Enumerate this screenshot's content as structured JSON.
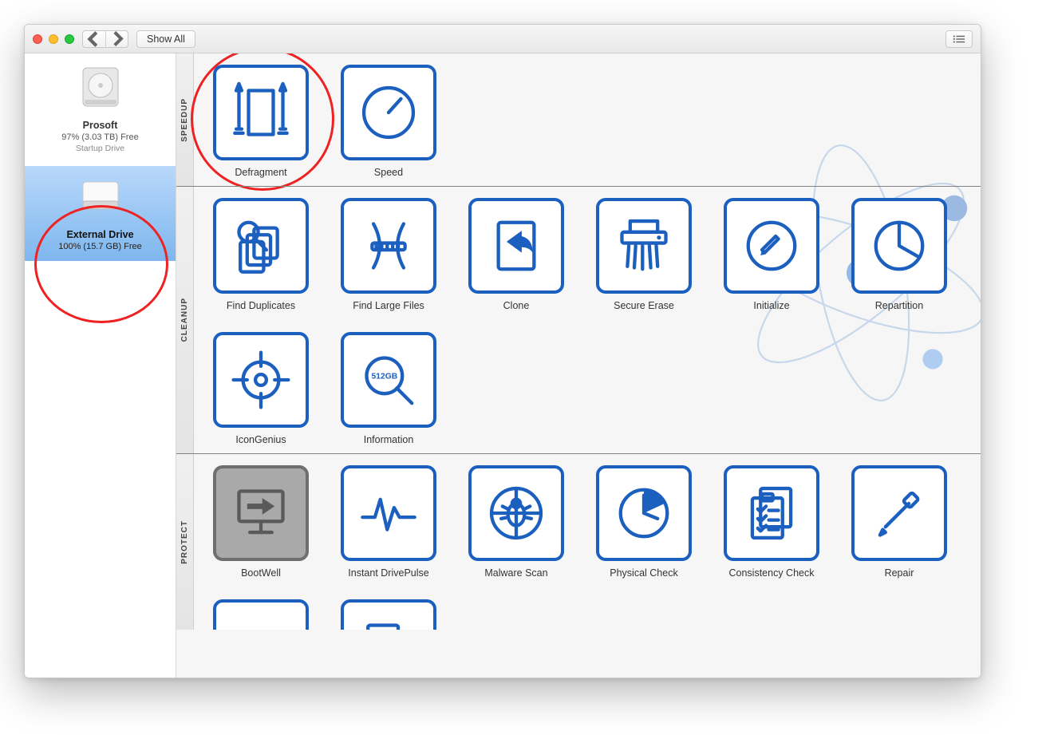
{
  "toolbar": {
    "show_all_label": "Show All"
  },
  "sidebar": {
    "drives": [
      {
        "name": "Prosoft",
        "free": "97% (3.03 TB) Free",
        "sub": "Startup Drive",
        "type": "internal",
        "selected": false
      },
      {
        "name": "External Drive",
        "free": "100% (15.7 GB) Free",
        "sub": "",
        "type": "external",
        "selected": true
      }
    ]
  },
  "sections": [
    {
      "label": "SPEEDUP",
      "tools": [
        {
          "label": "Defragment",
          "icon": "defragment",
          "disabled": false
        },
        {
          "label": "Speed",
          "icon": "speedometer",
          "disabled": false
        }
      ]
    },
    {
      "label": "CLEANUP",
      "tools": [
        {
          "label": "Find Duplicates",
          "icon": "duplicates",
          "disabled": false
        },
        {
          "label": "Find Large Files",
          "icon": "corset",
          "disabled": false
        },
        {
          "label": "Clone",
          "icon": "clone",
          "disabled": false
        },
        {
          "label": "Secure Erase",
          "icon": "shredder",
          "disabled": false
        },
        {
          "label": "Initialize",
          "icon": "pencil-circle",
          "disabled": false
        },
        {
          "label": "Repartition",
          "icon": "pie",
          "disabled": false
        },
        {
          "label": "IconGenius",
          "icon": "target",
          "disabled": false
        },
        {
          "label": "Information",
          "icon": "info-mag",
          "disabled": false,
          "badge": "512GB"
        }
      ]
    },
    {
      "label": "PROTECT",
      "tools": [
        {
          "label": "BootWell",
          "icon": "monitor-arrow",
          "disabled": true
        },
        {
          "label": "Instant DrivePulse",
          "icon": "pulse",
          "disabled": false
        },
        {
          "label": "Malware Scan",
          "icon": "bug-target",
          "disabled": false
        },
        {
          "label": "Physical Check",
          "icon": "clock-pie",
          "disabled": false
        },
        {
          "label": "Consistency Check",
          "icon": "checklist",
          "disabled": false
        },
        {
          "label": "Repair",
          "icon": "screwdriver",
          "disabled": false
        },
        {
          "label": "",
          "icon": "rebuild",
          "disabled": false
        },
        {
          "label": "",
          "icon": "report",
          "disabled": false
        }
      ]
    }
  ],
  "annotations": {
    "ring_sidebar": true,
    "ring_defragment": true
  }
}
